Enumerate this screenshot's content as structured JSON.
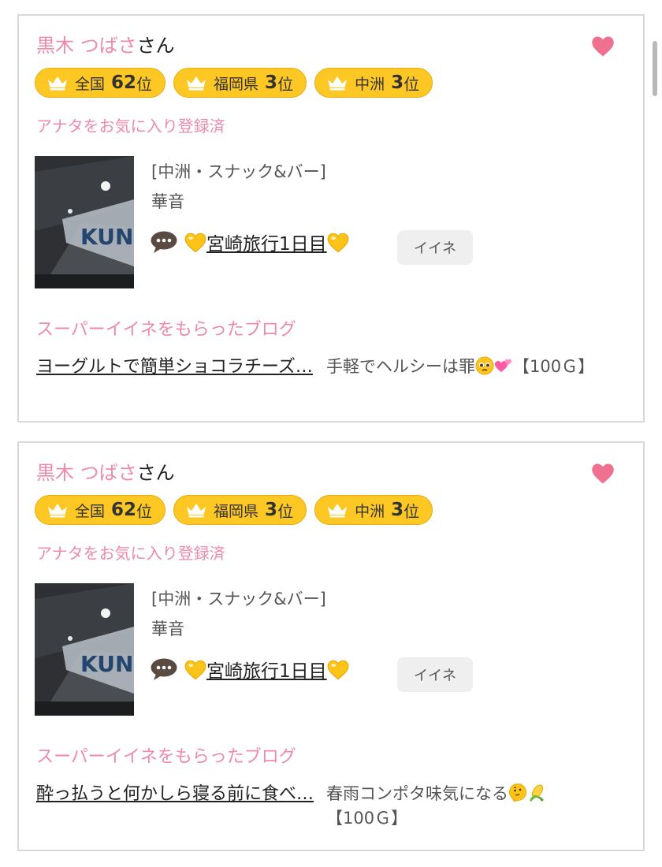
{
  "cards": [
    {
      "user_name": "黒木 つばさ",
      "name_suffix": "さん",
      "badges": [
        {
          "region": "全国",
          "rank": "62",
          "unit": "位"
        },
        {
          "region": "福岡県",
          "rank": "3",
          "unit": "位"
        },
        {
          "region": "中洲",
          "rank": "3",
          "unit": "位"
        }
      ],
      "favorite_status": "アナタをお気に入り登録済",
      "shop_category": "[中洲・スナック&バー]",
      "shop_name": "華音",
      "blog_title": "宮崎旅行1日目",
      "iine_label": "イイネ",
      "super_label": "スーパーイイネをもらったブログ",
      "super_blog_title": "ヨーグルトで簡単ショコラチーズ…",
      "super_blog_desc": "手軽でヘルシーは罪",
      "super_blog_points": "【100Ｇ】"
    },
    {
      "user_name": "黒木 つばさ",
      "name_suffix": "さん",
      "badges": [
        {
          "region": "全国",
          "rank": "62",
          "unit": "位"
        },
        {
          "region": "福岡県",
          "rank": "3",
          "unit": "位"
        },
        {
          "region": "中洲",
          "rank": "3",
          "unit": "位"
        }
      ],
      "favorite_status": "アナタをお気に入り登録済",
      "shop_category": "[中洲・スナック&バー]",
      "shop_name": "華音",
      "blog_title": "宮崎旅行1日目",
      "iine_label": "イイネ",
      "super_label": "スーパーイイネをもらったブログ",
      "super_blog_title": "酔っ払うと何かしら寝る前に食べ…",
      "super_blog_desc": "春雨コンポタ味気になる",
      "super_blog_points": "【100Ｇ】"
    }
  ],
  "icons": {
    "favorite": "heart-icon",
    "badge": "crown-icon",
    "message": "speech-bubble-icon",
    "blog_title_deco": "yellow-heart-emoji",
    "card1_desc_emojis": [
      "pleading-face-emoji",
      "two-hearts-emoji"
    ],
    "card2_desc_emojis": [
      "thinking-face-emoji",
      "corn-emoji"
    ]
  },
  "colors": {
    "accent_pink": "#ef8aa8",
    "badge_yellow": "#fdc724",
    "card_border": "#d9d9d9",
    "button_gray": "#efefef"
  }
}
